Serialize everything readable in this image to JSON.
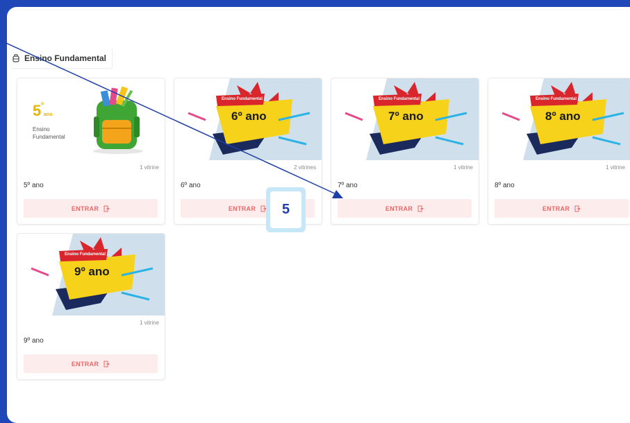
{
  "section": {
    "title": "Ensino Fundamental"
  },
  "cards": [
    {
      "banner_label": "",
      "name": "5º ano",
      "count": "1 vitrine",
      "enter_label": "ENTRAR",
      "fifth_big": "5",
      "fifth_sup": "º",
      "fifth_small": "ano",
      "fifth_sub1": "Ensino",
      "fifth_sub2": "Fundamental"
    },
    {
      "banner_tag": "Ensino Fundamental",
      "banner_label": "6º ano",
      "name": "6º ano",
      "count": "2 vitrines",
      "enter_label": "ENTRAR"
    },
    {
      "banner_tag": "Ensino Fundamental",
      "banner_label": "7º ano",
      "name": "7º ano",
      "count": "1 vitrine",
      "enter_label": "ENTRAR"
    },
    {
      "banner_tag": "Ensino Fundamental",
      "banner_label": "8º ano",
      "name": "8º ano",
      "count": "1 vitrine",
      "enter_label": "ENTRAR"
    },
    {
      "banner_tag": "Ensino Fundamental",
      "banner_label": "9º ano",
      "name": "9º ano",
      "count": "1 vitrine",
      "enter_label": "ENTRAR"
    }
  ],
  "annotation": {
    "step_number": "5"
  },
  "colors": {
    "frame": "#1f47b8",
    "enter_bg": "#fdecec",
    "enter_text": "#e36b6b",
    "banner_yellow": "#f7d21a",
    "banner_red": "#d9262c"
  }
}
